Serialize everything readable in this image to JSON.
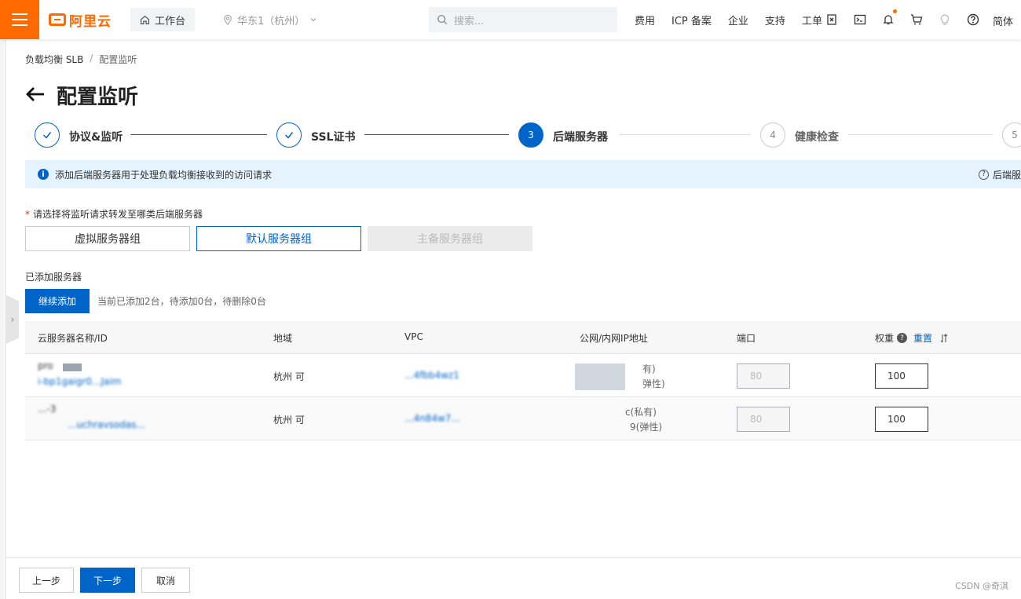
{
  "topbar": {
    "logo": "阿里云",
    "workbench": "工作台",
    "region": "华东1（杭州）",
    "search_placeholder": "搜索...",
    "links": [
      "费用",
      "ICP 备案",
      "企业",
      "支持",
      "工单"
    ],
    "language": "简体",
    "icons": [
      "cloud-shell-icon",
      "terminal-icon",
      "bell-icon",
      "cart-icon",
      "bulb-icon",
      "help-icon"
    ],
    "accent": "#ff6a00"
  },
  "breadcrumb": {
    "parent": "负载均衡 SLB",
    "separator": "/",
    "current": "配置监听"
  },
  "page_title": "配置监听",
  "steps": [
    {
      "index": "1",
      "label": "协议&监听",
      "status": "done"
    },
    {
      "index": "2",
      "label": "SSL证书",
      "status": "done"
    },
    {
      "index": "3",
      "label": "后端服务器",
      "status": "active"
    },
    {
      "index": "4",
      "label": "健康检查",
      "status": "todo"
    },
    {
      "index": "5",
      "label": "",
      "status": "todo"
    }
  ],
  "notice": {
    "text": "添加后端服务器用于处理负载均衡接收到的访问请求",
    "right_link": "后端服"
  },
  "server_type": {
    "label": "请选择将监听请求转发至哪类后端服务器",
    "options": [
      {
        "label": "虚拟服务器组",
        "state": "normal"
      },
      {
        "label": "默认服务器组",
        "state": "selected"
      },
      {
        "label": "主备服务器组",
        "state": "disabled"
      }
    ]
  },
  "added": {
    "label": "已添加服务器",
    "add_button": "继续添加",
    "summary": "当前已添加2台，待添加0台，待删除0台"
  },
  "table": {
    "headers": {
      "name": "云服务器名称/ID",
      "region": "地域",
      "vpc": "VPC",
      "ip": "公网/内网IP地址",
      "port": "端口",
      "weight": "权重",
      "reset": "重置"
    },
    "rows": [
      {
        "name": "pro",
        "id": "i-bp1gaigr0...Jaim",
        "region": "杭州 可",
        "vpc": "...4fbb4wz1",
        "ip_private_suffix": "有)",
        "ip_public_suffix": "弹性)",
        "port_placeholder": "80",
        "weight": "100"
      },
      {
        "name": "...-3",
        "id": "...uchravsodas...",
        "region": "杭州 可",
        "vpc": "...4n84w7...",
        "ip_private_suffix": "c(私有)",
        "ip_public_suffix": "9(弹性)",
        "port_placeholder": "80",
        "weight": "100"
      }
    ]
  },
  "footer": {
    "prev": "上一步",
    "next": "下一步",
    "cancel": "取消",
    "watermark": "CSDN @奇淇"
  },
  "colors": {
    "primary": "#0064c8",
    "notice_bg": "#e5f3ff"
  }
}
